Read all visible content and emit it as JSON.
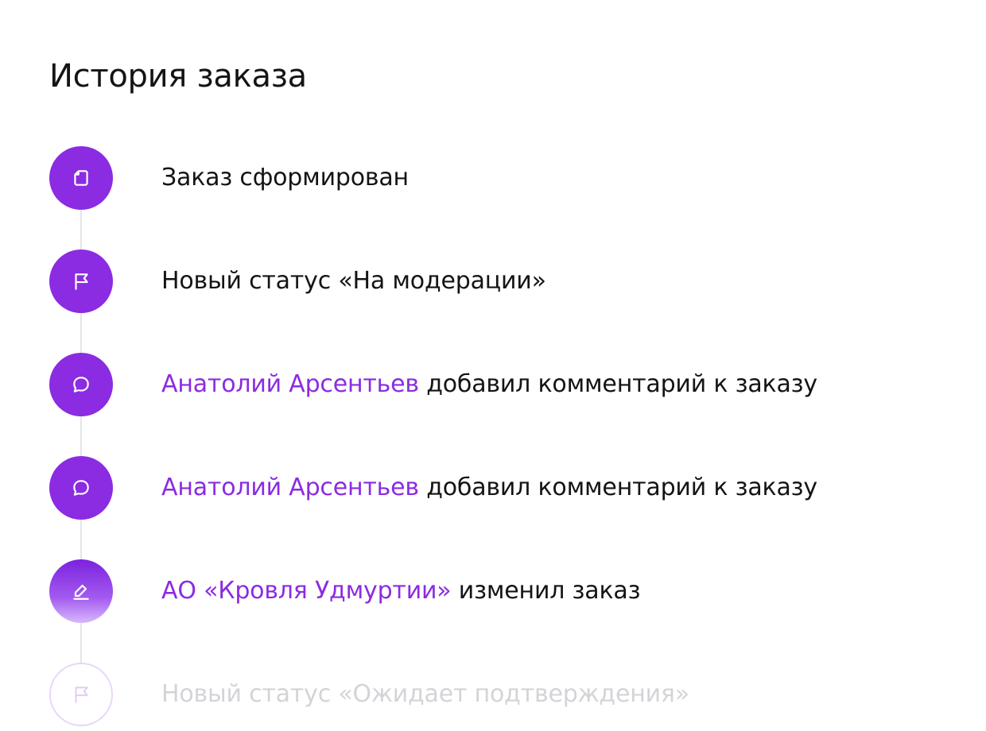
{
  "header": {
    "title": "История заказа"
  },
  "colors": {
    "accent": "#8b2be2",
    "text": "#141414",
    "muted": "#d4d4d8",
    "line": "#e4e4ea"
  },
  "events": [
    {
      "icon": "document-icon",
      "text": "Заказ сформирован"
    },
    {
      "icon": "flag-icon",
      "text": "Новый статус «На модерации»"
    },
    {
      "icon": "comment-icon",
      "actor": "Анатолий Арсентьев",
      "text": " добавил комментарий к заказу"
    },
    {
      "icon": "comment-icon",
      "actor": "Анатолий Арсентьев",
      "text": " добавил комментарий к заказу"
    },
    {
      "icon": "edit-icon",
      "actor": "АО «Кровля Удмуртии»",
      "text": " изменил заказ"
    },
    {
      "icon": "flag-icon",
      "text": "Новый статус «Ожидает подтверждения»",
      "state": "faded"
    }
  ]
}
